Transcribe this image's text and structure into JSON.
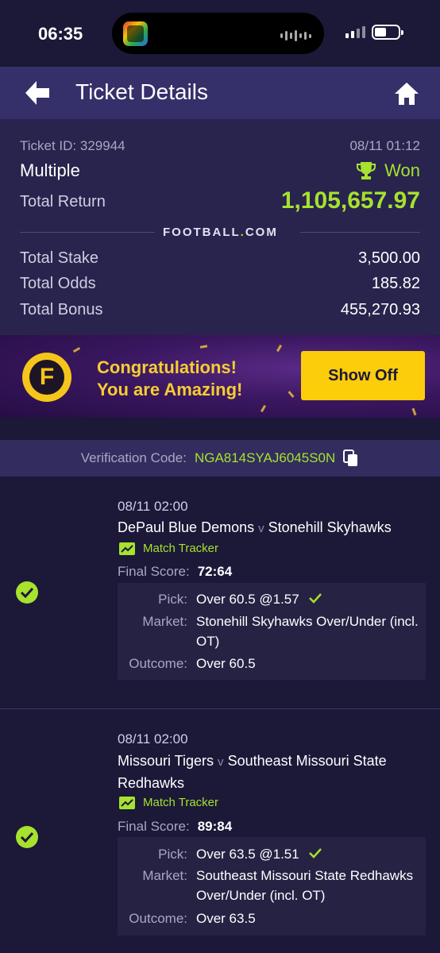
{
  "status": {
    "time": "06:35"
  },
  "header": {
    "title": "Ticket Details"
  },
  "summary": {
    "ticket_id": "Ticket ID: 329944",
    "date": "08/11 01:12",
    "bet_type": "Multiple",
    "status": "Won",
    "total_return_label": "Total Return",
    "total_return": "1,105,657.97",
    "brand": "FOOTBALL",
    "brand_dot": ".",
    "brand_suffix": "COM",
    "total_stake_label": "Total Stake",
    "total_stake": "3,500.00",
    "total_odds_label": "Total Odds",
    "total_odds": "185.82",
    "total_bonus_label": "Total Bonus",
    "total_bonus": "455,270.93"
  },
  "banner": {
    "logo_letter": "F",
    "line1": "Congratulations!",
    "line2": "You are Amazing!",
    "button": "Show Off"
  },
  "verification": {
    "label": "Verification Code:",
    "code": "NGA814SYAJ6045S0N"
  },
  "legs": [
    {
      "date": "08/11 02:00",
      "home": "DePaul Blue Demons",
      "vs": "v",
      "away": "Stonehill Skyhawks",
      "tracker": "Match Tracker",
      "final_label": "Final Score:",
      "final_score": "72:64",
      "pick_label": "Pick:",
      "pick": "Over 60.5 @1.57",
      "market_label": "Market:",
      "market": "Stonehill Skyhawks Over/Under (incl. OT)",
      "outcome_label": "Outcome:",
      "outcome": "Over 60.5"
    },
    {
      "date": "08/11 02:00",
      "home": "Missouri Tigers",
      "vs": "v",
      "away": "Southeast Missouri State Redhawks",
      "tracker": "Match Tracker",
      "final_label": "Final Score:",
      "final_score": "89:84",
      "pick_label": "Pick:",
      "pick": "Over 63.5 @1.51",
      "market_label": "Market:",
      "market": "Southeast Missouri State Redhawks Over/Under (incl. OT)",
      "outcome_label": "Outcome:",
      "outcome": "Over 63.5"
    }
  ],
  "colors": {
    "accent_green": "#a6e22e",
    "button_yellow": "#fccd0b",
    "header": "#352f6a"
  }
}
